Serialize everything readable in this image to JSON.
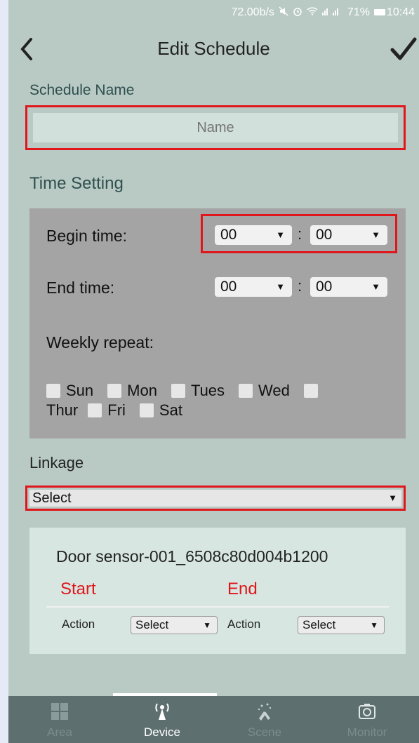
{
  "status_bar": {
    "network_speed": "72.00b/s",
    "battery_percent": "71%",
    "time": "10:44"
  },
  "header": {
    "title": "Edit Schedule",
    "back_icon": "chevron-left-icon",
    "done_icon": "checkmark-icon"
  },
  "schedule_name": {
    "label": "Schedule Name",
    "placeholder": "Name",
    "value": ""
  },
  "time_setting": {
    "label": "Time Setting",
    "begin": {
      "label": "Begin time:",
      "hour": "00",
      "minute": "00"
    },
    "end": {
      "label": "End time:",
      "hour": "00",
      "minute": "00"
    },
    "colon": ":",
    "weekly_repeat_label": "Weekly repeat:",
    "days": [
      "Sun",
      "Mon",
      "Tues",
      "Wed",
      "Thur",
      "Fri",
      "Sat"
    ]
  },
  "linkage": {
    "label": "Linkage",
    "selected": "Select"
  },
  "device_card": {
    "device_name": "Door sensor-001_6508c80d004b1200",
    "start_label": "Start",
    "end_label": "End",
    "start_action_label": "Action",
    "start_action_value": "Select",
    "end_action_label": "Action",
    "end_action_value": "Select"
  },
  "tabs": [
    {
      "label": "Area",
      "icon": "grid-icon",
      "active": false
    },
    {
      "label": "Device",
      "icon": "antenna-icon",
      "active": true
    },
    {
      "label": "Scene",
      "icon": "scene-icon",
      "active": false
    },
    {
      "label": "Monitor",
      "icon": "camera-icon",
      "active": false
    }
  ],
  "colors": {
    "background": "#b9cac5",
    "highlight": "#e0161c",
    "panel": "#a4a4a4",
    "tabbar": "#5e6f70"
  }
}
